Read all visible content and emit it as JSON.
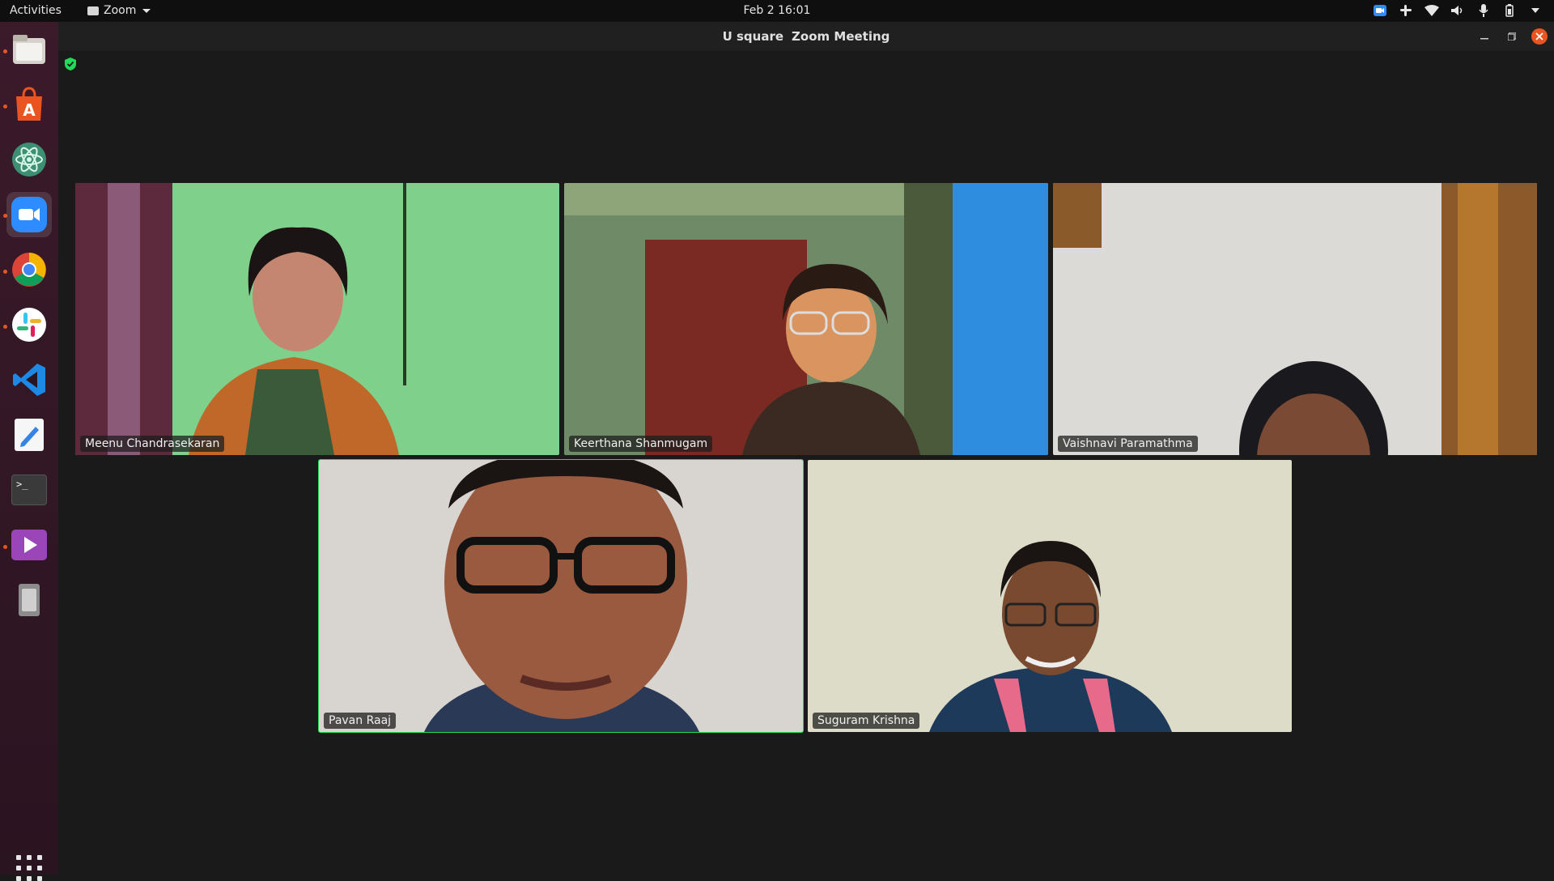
{
  "topbar": {
    "activities": "Activities",
    "app_menu": "Zoom",
    "clock": "Feb 2  16:01"
  },
  "window": {
    "title_part1": "U square",
    "title_part2": "Zoom Meeting"
  },
  "dock": {
    "items": [
      {
        "name": "files",
        "icon": "files-icon"
      },
      {
        "name": "software-center",
        "icon": "ubuntu-software-icon"
      },
      {
        "name": "atom",
        "icon": "atom-icon"
      },
      {
        "name": "zoom",
        "icon": "zoom-icon"
      },
      {
        "name": "chrome",
        "icon": "chrome-icon"
      },
      {
        "name": "slack",
        "icon": "slack-icon"
      },
      {
        "name": "vscode",
        "icon": "vscode-icon"
      },
      {
        "name": "text-editor",
        "icon": "text-editor-icon"
      },
      {
        "name": "terminal",
        "icon": "terminal-icon"
      },
      {
        "name": "media-player",
        "icon": "media-player-icon"
      },
      {
        "name": "removable-drive",
        "icon": "drive-icon"
      }
    ],
    "terminal_prompt": ">_"
  },
  "participants": [
    {
      "name": "Meenu Chandrasekaran",
      "speaking": false
    },
    {
      "name": "Keerthana Shanmugam",
      "speaking": false
    },
    {
      "name": "Vaishnavi Paramathma",
      "speaking": false
    },
    {
      "name": "Pavan Raaj",
      "speaking": true
    },
    {
      "name": "Suguram Krishna",
      "speaking": false
    }
  ],
  "colors": {
    "active_speaker": "#23d959",
    "ubuntu_orange": "#e95420",
    "zoom_blue": "#2d8cff"
  }
}
